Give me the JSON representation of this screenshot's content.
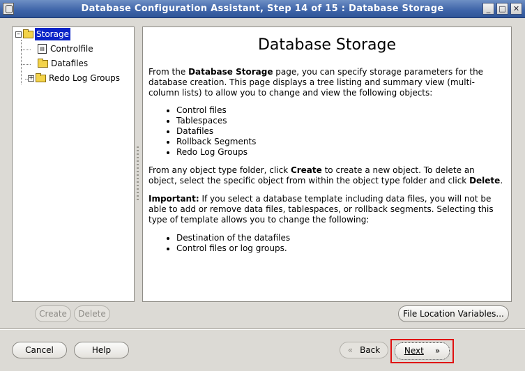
{
  "window": {
    "title": "Database Configuration Assistant, Step 14 of 15 : Database Storage"
  },
  "tree": {
    "root": "Storage",
    "children": [
      "Controlfile",
      "Datafiles",
      "Redo Log Groups"
    ]
  },
  "content": {
    "heading": "Database Storage",
    "p1_a": "From the ",
    "p1_bold": "Database Storage",
    "p1_b": " page, you can specify storage parameters for the database creation. This page displays a tree listing and summary view (multi-column lists) to allow you to change and view the following objects:",
    "list1": [
      "Control files",
      "Tablespaces",
      "Datafiles",
      "Rollback Segments",
      "Redo Log Groups"
    ],
    "p2_a": "From any object type folder, click ",
    "p2_b1": "Create",
    "p2_b": " to create a new object. To delete an object, select the specific object from within the object type folder and click ",
    "p2_b2": "Delete",
    "p2_c": ".",
    "p3_bold": "Important:",
    "p3_rest": " If you select a database template including data files, you will not be able to add or remove data files, tablespaces, or rollback segments. Selecting this type of template allows you to change the following:",
    "list2": [
      "Destination of the datafiles",
      "Control files or log groups."
    ]
  },
  "buttons": {
    "create": "Create",
    "delete": "Delete",
    "file_location": "File Location Variables...",
    "cancel": "Cancel",
    "help": "Help",
    "back": "Back",
    "back_arrow": "«",
    "next": "Next",
    "next_arrow": "»"
  }
}
